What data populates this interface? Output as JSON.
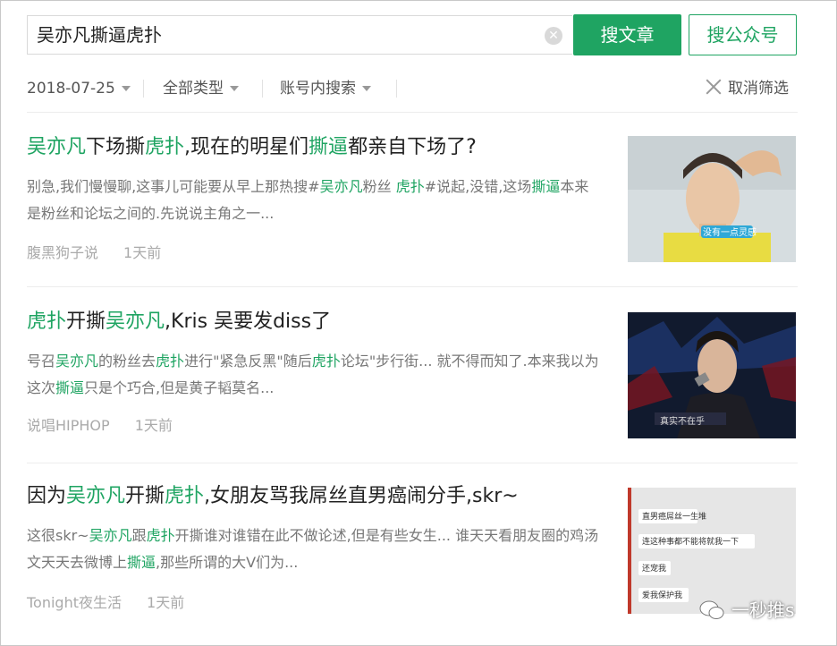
{
  "search": {
    "query": "吴亦凡撕逼虎扑",
    "clear_icon": "clear-circle-icon",
    "search_articles_label": "搜文章",
    "search_accounts_label": "搜公众号"
  },
  "filters": {
    "date": "2018-07-25",
    "type": "全部类型",
    "scope": "账号内搜索",
    "cancel_label": "取消筛选"
  },
  "colors": {
    "accent": "#1fa462",
    "meta": "#aaaaaa"
  },
  "results": [
    {
      "title": [
        {
          "t": "吴亦凡",
          "hl": true
        },
        {
          "t": "下场撕",
          "hl": false
        },
        {
          "t": "虎扑",
          "hl": true
        },
        {
          "t": ",现在的明星们",
          "hl": false
        },
        {
          "t": "撕逼",
          "hl": true
        },
        {
          "t": "都亲自下场了?",
          "hl": false
        }
      ],
      "desc": [
        {
          "t": "别急,我们慢慢聊,这事儿可能要从早上那热搜#",
          "hl": false
        },
        {
          "t": "吴亦凡",
          "hl": true
        },
        {
          "t": "粉丝 ",
          "hl": false
        },
        {
          "t": "虎扑",
          "hl": true
        },
        {
          "t": "#说起,没错,这场",
          "hl": false
        },
        {
          "t": "撕逼",
          "hl": true
        },
        {
          "t": "本来是粉丝和论坛之间的.先说说主角之一...",
          "hl": false
        }
      ],
      "source": "腹黑狗子说",
      "time": "1天前",
      "thumb_caption": "没有一点灵感"
    },
    {
      "title": [
        {
          "t": "虎扑",
          "hl": true
        },
        {
          "t": "开撕",
          "hl": false
        },
        {
          "t": "吴亦凡",
          "hl": true
        },
        {
          "t": ",Kris 吴要发diss了",
          "hl": false
        }
      ],
      "desc": [
        {
          "t": "号召",
          "hl": false
        },
        {
          "t": "吴亦凡",
          "hl": true
        },
        {
          "t": "的粉丝去",
          "hl": false
        },
        {
          "t": "虎扑",
          "hl": true
        },
        {
          "t": "进行\"紧急反黑\"随后",
          "hl": false
        },
        {
          "t": "虎扑",
          "hl": true
        },
        {
          "t": "论坛\"步行街... 就不得而知了.本来我以为这次",
          "hl": false
        },
        {
          "t": "撕逼",
          "hl": true
        },
        {
          "t": "只是个巧合,但是黄子韬莫名...",
          "hl": false
        }
      ],
      "source": "说唱HIPHOP",
      "time": "1天前",
      "thumb_caption": "真实不在乎"
    },
    {
      "title": [
        {
          "t": "因为",
          "hl": false
        },
        {
          "t": "吴亦凡",
          "hl": true
        },
        {
          "t": "开撕",
          "hl": false
        },
        {
          "t": "虎扑",
          "hl": true
        },
        {
          "t": ",女朋友骂我屌丝直男癌闹分手,skr~",
          "hl": false
        }
      ],
      "desc": [
        {
          "t": "这很skr~",
          "hl": false
        },
        {
          "t": "吴亦凡",
          "hl": true
        },
        {
          "t": "跟",
          "hl": false
        },
        {
          "t": "虎扑",
          "hl": true
        },
        {
          "t": "开撕谁对谁错在此不做论述,但是有些女生... 谁天天看朋友圈的鸡汤文天天去微博上",
          "hl": false
        },
        {
          "t": "撕逼",
          "hl": true
        },
        {
          "t": ",那些所谓的大V们为...",
          "hl": false
        }
      ],
      "source": "Tonight夜生活",
      "time": "1天前",
      "chat_lines": [
        "直男癌屌丝一生堆",
        "连这种事都不能将就我一下",
        "还宠我",
        "爱我保护我"
      ]
    }
  ],
  "watermark": {
    "text": "一秒推s",
    "icon": "wechat-icon"
  }
}
